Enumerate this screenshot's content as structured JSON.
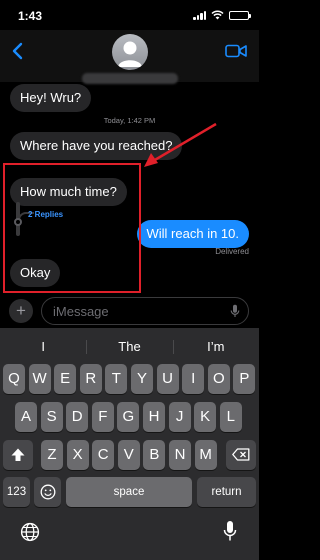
{
  "status_bar": {
    "time": "1:43",
    "battery_level": 0.9
  },
  "header": {
    "back_icon": "chevron-left-icon",
    "video_icon": "video-camera-icon",
    "contact_name_hidden": true
  },
  "conversation": {
    "timestamp_day": "Today",
    "timestamp_time": "1:42 PM",
    "messages": [
      {
        "text": "Hey! Wru?",
        "direction": "incoming"
      },
      {
        "text": "Where have you reached?",
        "direction": "incoming"
      },
      {
        "text": "How much time?",
        "direction": "incoming"
      },
      {
        "text": "Will reach in 10.",
        "direction": "outgoing"
      },
      {
        "text": "Okay",
        "direction": "incoming"
      }
    ],
    "thread_replies": "2 Replies",
    "delivery_status": "Delivered",
    "annotation_color": "#e0202a"
  },
  "composer": {
    "plus_label": "+",
    "placeholder": "iMessage"
  },
  "keyboard": {
    "suggestions": [
      "I",
      "The",
      "I’m"
    ],
    "row1": [
      "Q",
      "W",
      "E",
      "R",
      "T",
      "Y",
      "U",
      "I",
      "O",
      "P"
    ],
    "row2": [
      "A",
      "S",
      "D",
      "F",
      "G",
      "H",
      "J",
      "K",
      "L"
    ],
    "row3": [
      "Z",
      "X",
      "C",
      "V",
      "B",
      "N",
      "M"
    ],
    "numbers_label": "123",
    "space_label": "space",
    "return_label": "return",
    "emoji_icon": "emoji-icon",
    "globe_icon": "globe-icon",
    "dictation_icon": "microphone-icon"
  },
  "colors": {
    "accent": "#1a8cff",
    "incoming_bubble": "#262628",
    "highlight": "#e0202a"
  }
}
